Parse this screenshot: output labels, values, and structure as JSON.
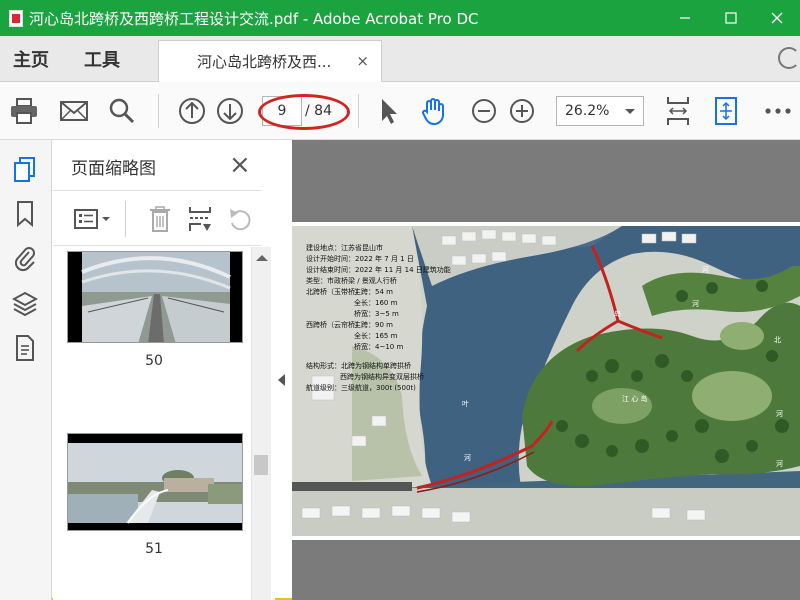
{
  "window": {
    "title": "河心岛北跨桥及西跨桥工程设计交流.pdf - Adobe Acrobat Pro DC",
    "app_title_bar_color": "#1aa33f"
  },
  "tabs": {
    "home": "主页",
    "tools": "工具",
    "document_tab": "河心岛北跨桥及西...",
    "close_symbol": "×"
  },
  "toolbar": {
    "current_page": "9",
    "page_total": "/ 84",
    "zoom": "26.2%"
  },
  "thumbnail_panel": {
    "title": "页面缩略图",
    "thumbnails": [
      {
        "label": "50"
      },
      {
        "label": "51"
      }
    ]
  },
  "document": {
    "info_lines": [
      "建设地点：江苏省昆山市",
      "设计开始时间：2022 年 7 月 1 日",
      "设计结束时间：2022 年 11 月 14 日建筑功能",
      "类型：市政桥梁 / 景观人行桥",
      "北跨桥（玉带桥）",
      "主跨：54 m",
      "全长：160 m",
      "桥宽：3~5 m",
      "西跨桥（云帘桥）",
      "主跨：90 m",
      "全长：165 m",
      "桥宽：4~10 m",
      "结构形式：北跨为钢结构单跨拱桥",
      "西跨为钢结构异变双层拱桥",
      "航道级别：三级航道，300t (500t)"
    ],
    "map_labels": [
      "河",
      "岛",
      "河",
      "北",
      "叶",
      "江 心 岛",
      "河",
      "河",
      "河"
    ]
  }
}
